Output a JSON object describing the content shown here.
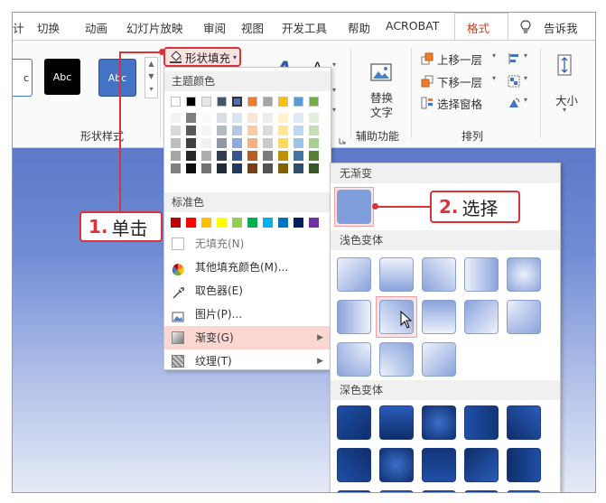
{
  "tabs": [
    "计",
    "切换",
    "动画",
    "幻灯片放映",
    "审阅",
    "视图",
    "开发工具",
    "帮助",
    "ACROBAT",
    "格式",
    "告诉我"
  ],
  "ribbon": {
    "style_samples": [
      "c",
      "Abc",
      "Abc"
    ],
    "group_shape_styles": "形状样式",
    "shape_fill_button": "形状填充",
    "wordart_a": "A",
    "replace_text_line1": "替换",
    "replace_text_line2": "文字",
    "group_accessibility": "辅助功能",
    "bring_forward": "上移一层",
    "send_backward": "下移一层",
    "selection_pane": "选择窗格",
    "group_arrange": "排列",
    "size_label": "大小"
  },
  "dropdown": {
    "theme_colors_header": "主题颜色",
    "standard_colors_header": "标准色",
    "no_fill": "无填充(N)",
    "more_fill_colors": "其他填充颜色(M)...",
    "eyedropper": "取色器(E)",
    "picture": "图片(P)...",
    "gradient": "渐变(G)",
    "texture": "纹理(T)",
    "theme_top_row": [
      "#ffffff",
      "#000000",
      "#e7e6e6",
      "#44546a",
      "#4472c4",
      "#ed7d31",
      "#a5a5a5",
      "#ffc000",
      "#5b9bd5",
      "#70ad47"
    ],
    "standard_colors": [
      "#c00000",
      "#ff0000",
      "#ffc000",
      "#ffff00",
      "#92d050",
      "#00b050",
      "#00b0f0",
      "#0070c0",
      "#002060",
      "#7030a0"
    ]
  },
  "submenu": {
    "no_gradient_header": "无渐变",
    "light_variations_header": "浅色变体",
    "dark_variations_header": "深色变体"
  },
  "callouts": {
    "step1_num": "1.",
    "step1_text": "单击",
    "step2_num": "2.",
    "step2_text": "选择"
  }
}
